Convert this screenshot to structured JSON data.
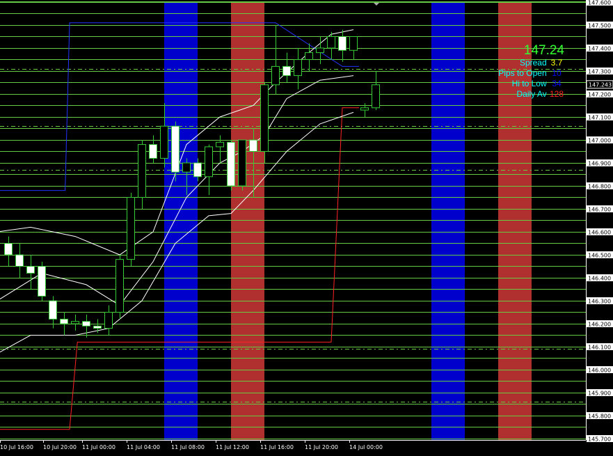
{
  "chart_data": {
    "type": "candlestick",
    "instrument_price": "147.24",
    "current_price_label": "147.243",
    "y_ticks": [
      "147.600",
      "147.500",
      "147.400",
      "147.300",
      "147.200",
      "147.100",
      "147.000",
      "146.900",
      "146.800",
      "146.700",
      "146.600",
      "146.500",
      "146.400",
      "146.300",
      "146.200",
      "146.100",
      "146.000",
      "145.900",
      "145.800",
      "145.700"
    ],
    "ylim": [
      145.7,
      147.6
    ],
    "x_ticks": [
      "10 Jul 16:00",
      "10 Jul 20:00",
      "11 Jul 00:00",
      "11 Jul 04:00",
      "11 Jul 08:00",
      "11 Jul 12:00",
      "11 Jul 16:00",
      "11 Jul 20:00",
      "14 Jul 00:00"
    ],
    "candles": [
      {
        "o": 146.55,
        "h": 146.58,
        "l": 146.45,
        "c": 146.5
      },
      {
        "o": 146.5,
        "h": 146.55,
        "l": 146.4,
        "c": 146.45
      },
      {
        "o": 146.45,
        "h": 146.5,
        "l": 146.35,
        "c": 146.42
      },
      {
        "o": 146.45,
        "h": 146.47,
        "l": 146.3,
        "c": 146.32
      },
      {
        "o": 146.3,
        "h": 146.32,
        "l": 146.18,
        "c": 146.22
      },
      {
        "o": 146.22,
        "h": 146.25,
        "l": 146.15,
        "c": 146.2
      },
      {
        "o": 146.2,
        "h": 146.24,
        "l": 146.17,
        "c": 146.21
      },
      {
        "o": 146.21,
        "h": 146.24,
        "l": 146.14,
        "c": 146.19
      },
      {
        "o": 146.19,
        "h": 146.22,
        "l": 146.16,
        "c": 146.18
      },
      {
        "o": 146.18,
        "h": 146.28,
        "l": 146.15,
        "c": 146.25
      },
      {
        "o": 146.25,
        "h": 146.5,
        "l": 146.22,
        "c": 146.48
      },
      {
        "o": 146.48,
        "h": 146.77,
        "l": 146.45,
        "c": 146.75
      },
      {
        "o": 146.75,
        "h": 147.0,
        "l": 146.7,
        "c": 146.98
      },
      {
        "o": 146.98,
        "h": 147.02,
        "l": 146.9,
        "c": 146.92
      },
      {
        "o": 146.92,
        "h": 147.16,
        "l": 146.88,
        "c": 147.06
      },
      {
        "o": 147.06,
        "h": 147.08,
        "l": 146.82,
        "c": 146.86
      },
      {
        "o": 146.86,
        "h": 146.92,
        "l": 146.76,
        "c": 146.9
      },
      {
        "o": 146.9,
        "h": 146.92,
        "l": 146.82,
        "c": 146.84
      },
      {
        "o": 146.84,
        "h": 146.98,
        "l": 146.76,
        "c": 146.97
      },
      {
        "o": 146.97,
        "h": 147.02,
        "l": 146.9,
        "c": 146.99
      },
      {
        "o": 146.99,
        "h": 147.0,
        "l": 146.78,
        "c": 146.8
      },
      {
        "o": 146.8,
        "h": 146.98,
        "l": 146.78,
        "c": 147.0
      },
      {
        "o": 147.0,
        "h": 147.05,
        "l": 146.75,
        "c": 146.95
      },
      {
        "o": 146.95,
        "h": 147.25,
        "l": 146.9,
        "c": 147.24
      },
      {
        "o": 147.24,
        "h": 147.5,
        "l": 147.2,
        "c": 147.32
      },
      {
        "o": 147.32,
        "h": 147.38,
        "l": 147.25,
        "c": 147.28
      },
      {
        "o": 147.28,
        "h": 147.4,
        "l": 147.22,
        "c": 147.35
      },
      {
        "o": 147.35,
        "h": 147.42,
        "l": 147.3,
        "c": 147.38
      },
      {
        "o": 147.38,
        "h": 147.45,
        "l": 147.33,
        "c": 147.4
      },
      {
        "o": 147.4,
        "h": 147.47,
        "l": 147.35,
        "c": 147.45
      },
      {
        "o": 147.45,
        "h": 147.48,
        "l": 147.34,
        "c": 147.39
      },
      {
        "o": 147.39,
        "h": 147.45,
        "l": 147.35,
        "c": 147.45
      },
      {
        "o": 147.13,
        "h": 147.16,
        "l": 147.1,
        "c": 147.14
      },
      {
        "o": 147.14,
        "h": 147.3,
        "l": 147.13,
        "c": 147.24
      }
    ],
    "upper_band_high": [
      {
        "i": 5.5,
        "v": 147.51
      },
      {
        "i": 22,
        "v": 147.51
      },
      {
        "i": 24,
        "v": 147.51
      },
      {
        "i": 30,
        "v": 147.32
      },
      {
        "i": 31.5,
        "v": 147.32
      }
    ],
    "lower_band_low": [
      {
        "i": -1,
        "v": 145.74
      },
      {
        "i": 5.5,
        "v": 145.74
      },
      {
        "i": 6.2,
        "v": 146.12
      },
      {
        "i": 29,
        "v": 146.12
      },
      {
        "i": 30,
        "v": 147.14
      },
      {
        "i": 31.5,
        "v": 147.14
      }
    ],
    "ma_upper": [
      {
        "i": -1,
        "v": 146.6
      },
      {
        "i": 2,
        "v": 146.62
      },
      {
        "i": 6,
        "v": 146.58
      },
      {
        "i": 10,
        "v": 146.5
      },
      {
        "i": 13,
        "v": 146.6
      },
      {
        "i": 16,
        "v": 146.98
      },
      {
        "i": 19,
        "v": 147.1
      },
      {
        "i": 22,
        "v": 147.15
      },
      {
        "i": 24,
        "v": 147.25
      },
      {
        "i": 27,
        "v": 147.38
      },
      {
        "i": 29,
        "v": 147.46
      },
      {
        "i": 31,
        "v": 147.48
      }
    ],
    "ma_mid": [
      {
        "i": -1,
        "v": 146.3
      },
      {
        "i": 3,
        "v": 146.42
      },
      {
        "i": 7,
        "v": 146.37
      },
      {
        "i": 10,
        "v": 146.28
      },
      {
        "i": 13,
        "v": 146.47
      },
      {
        "i": 16,
        "v": 146.75
      },
      {
        "i": 19,
        "v": 146.9
      },
      {
        "i": 21,
        "v": 146.95
      },
      {
        "i": 23,
        "v": 147.02
      },
      {
        "i": 25,
        "v": 147.18
      },
      {
        "i": 28,
        "v": 147.26
      },
      {
        "i": 31,
        "v": 147.28
      }
    ],
    "ma_lower": [
      {
        "i": -1,
        "v": 146.07
      },
      {
        "i": 2,
        "v": 146.15
      },
      {
        "i": 6,
        "v": 146.15
      },
      {
        "i": 9,
        "v": 146.18
      },
      {
        "i": 12,
        "v": 146.3
      },
      {
        "i": 15,
        "v": 146.55
      },
      {
        "i": 18,
        "v": 146.67
      },
      {
        "i": 20,
        "v": 146.68
      },
      {
        "i": 22,
        "v": 146.78
      },
      {
        "i": 25,
        "v": 146.95
      },
      {
        "i": 28,
        "v": 147.07
      },
      {
        "i": 31,
        "v": 147.12
      }
    ],
    "session_bands": [
      {
        "from": "11 Jul 08:00",
        "to": "11 Jul 11:00",
        "color": "#0000cc"
      },
      {
        "from": "11 Jul 12:00",
        "to": "11 Jul 15:00",
        "color": "#b03030"
      },
      {
        "from": "14 Jul 08:00",
        "to": "14 Jul 11:00",
        "color": "#0000cc"
      },
      {
        "from": "14 Jul 14:00",
        "to": "14 Jul 17:00",
        "color": "#b03030"
      }
    ],
    "dashed_levels": [
      147.31,
      147.06,
      146.87,
      146.55,
      146.2,
      146.09,
      145.86
    ],
    "colors": {
      "background": "#000000",
      "grid": "#66cc44",
      "bull_fill": "#000000",
      "bear_fill": "#ffffff",
      "wick": "#33cc33",
      "ma": "#ffffff",
      "upper_band": "#2233ff",
      "lower_band": "#ff2222",
      "axis": "#ffffff",
      "axis_text": "#000000"
    }
  },
  "info_panel": {
    "price": "147.24",
    "rows": [
      {
        "label": "Spread",
        "value": "3.7",
        "value_color": "#ffff00"
      },
      {
        "label": "Pips to Open",
        "value": "10",
        "value_color": "#0000ff"
      },
      {
        "label": "Hi to Low",
        "value": "34",
        "value_color": "#0000ff"
      },
      {
        "label": "Daily Av",
        "value": "128",
        "value_color": "#ff2222"
      }
    ],
    "label_color": "#00ffff",
    "price_color": "#33ff33"
  }
}
